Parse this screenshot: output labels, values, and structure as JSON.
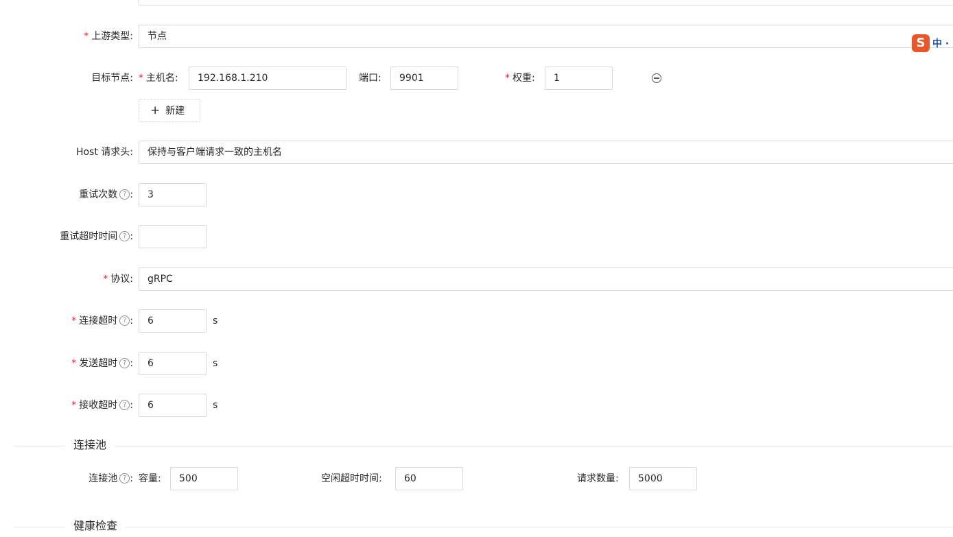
{
  "form": {
    "upstream_type": {
      "label": "上游类型",
      "value": "节点"
    },
    "target_nodes": {
      "label": "目标节点",
      "host_label": "主机名",
      "host_value": "192.168.1.210",
      "port_label": "端口",
      "port_value": "9901",
      "weight_label": "权重",
      "weight_value": "1",
      "add_label": "新建"
    },
    "host_header": {
      "label": "Host 请求头",
      "value": "保持与客户端请求一致的主机名"
    },
    "retries": {
      "label": "重试次数",
      "value": "3"
    },
    "retry_timeout": {
      "label": "重试超时时间",
      "value": ""
    },
    "protocol": {
      "label": "协议",
      "value": "gRPC"
    },
    "connect_timeout": {
      "label": "连接超时",
      "value": "6",
      "unit": "s"
    },
    "send_timeout": {
      "label": "发送超时",
      "value": "6",
      "unit": "s"
    },
    "read_timeout": {
      "label": "接收超时",
      "value": "6",
      "unit": "s"
    }
  },
  "keepalive_pool": {
    "section_title": "连接池",
    "label": "连接池",
    "size_label": "容量",
    "size_value": "500",
    "idle_label": "空闲超时时间",
    "idle_value": "60",
    "requests_label": "请求数量",
    "requests_value": "5000"
  },
  "health_check": {
    "section_title": "健康检查"
  },
  "ime": {
    "logo": "S",
    "text": "中 ·"
  },
  "symbols": {
    "required": "*",
    "colon": ":",
    "help": "?",
    "plus": "+"
  },
  "colors": {
    "required": "#f5222d",
    "border": "#d9d9d9",
    "ime_logo": "#e8562a"
  }
}
